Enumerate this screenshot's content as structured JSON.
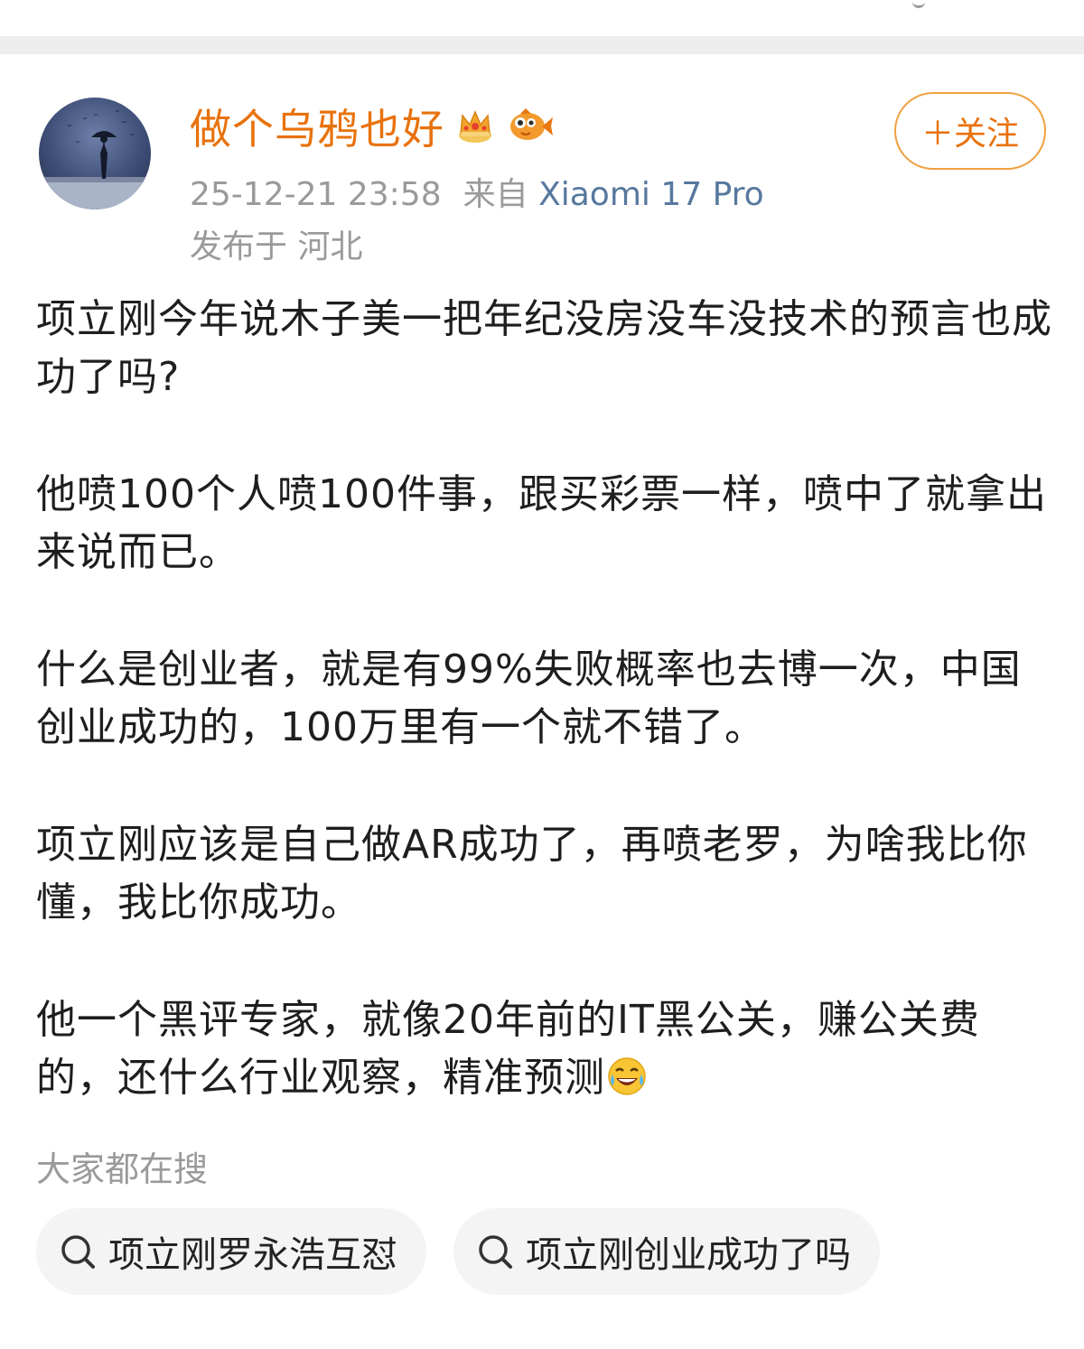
{
  "post": {
    "author": {
      "name": "做个乌鸦也好",
      "badges": [
        "crown-badge-icon",
        "fish-badge-icon"
      ]
    },
    "timestamp": "25-12-21 23:58",
    "source_prefix": "来自",
    "device": "Xiaomi 17 Pro",
    "location": "发布于 河北",
    "follow_label": "＋关注",
    "paragraphs": [
      "项立刚今年说木子美一把年纪没房没车没技术的预言也成功了吗?",
      "他喷100个人喷100件事，跟买彩票一样，喷中了就拿出来说而已。",
      "什么是创业者，就是有99%失败概率也去博一次，中国创业成功的，100万里有一个就不错了。",
      "项立刚应该是自己做AR成功了，再喷老罗，为啥我比你懂，我比你成功。",
      "他一个黑评专家，就像20年前的IT黑公关，赚公关费的，还什么行业观察，精准预测"
    ],
    "trailing_emoji": "laughing-tears-emoji-icon"
  },
  "search": {
    "title": "大家都在搜",
    "chips": [
      {
        "label": "项立刚罗永浩互怼",
        "icon": "search-icon"
      },
      {
        "label": "项立刚创业成功了吗",
        "icon": "search-icon"
      }
    ]
  },
  "colors": {
    "username": "#e8720c",
    "follow_border": "#f0a040",
    "device_link": "#57789e",
    "meta_gray": "#9a9a9a",
    "chip_bg": "#f4f4f4"
  }
}
